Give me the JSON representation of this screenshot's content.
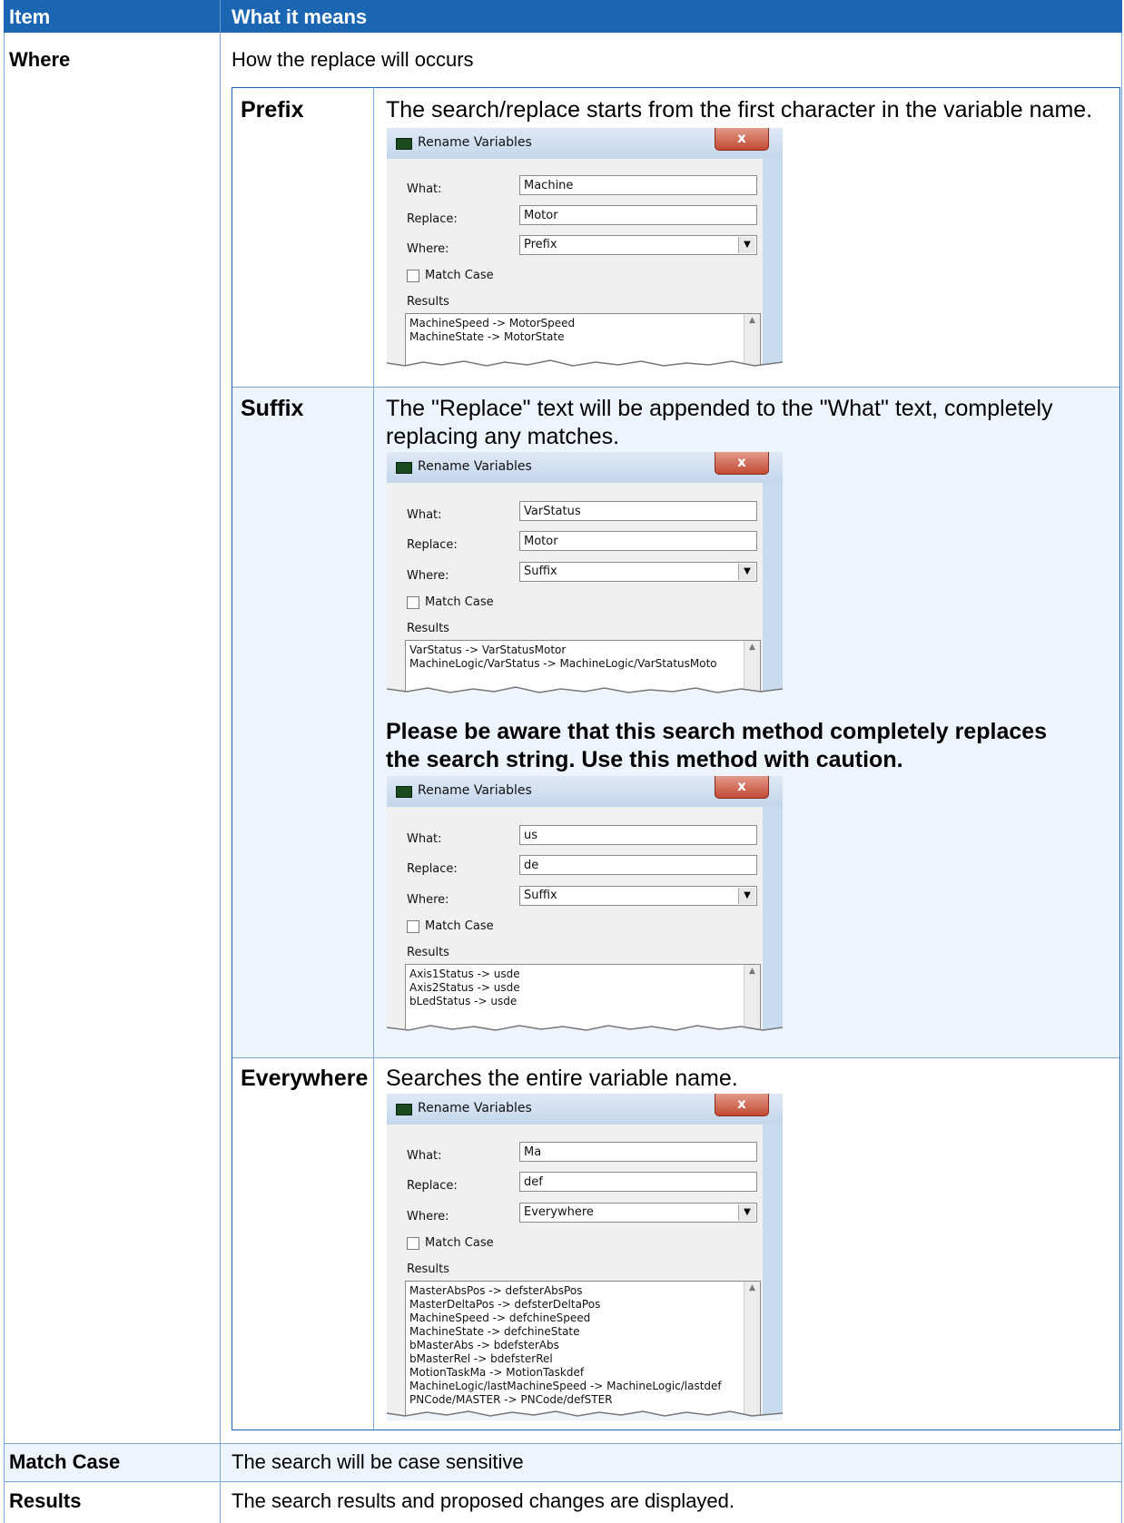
{
  "header": {
    "col_item": "Item",
    "col_meaning": "What it means"
  },
  "where": {
    "item": "Where",
    "description": "How the replace will occurs",
    "options": [
      {
        "name": "Prefix",
        "description": "The search/replace starts from the first character in the variable name.",
        "dialog": {
          "title": "Rename Variables",
          "close": "x",
          "what_label": "What:",
          "what": "Machine",
          "replace_label": "Replace:",
          "replace": "Motor",
          "where_label": "Where:",
          "where": "Prefix",
          "match_case": "Match Case",
          "results_label": "Results",
          "results": [
            "MachineSpeed -> MotorSpeed",
            "MachineState -> MotorState"
          ]
        }
      },
      {
        "name": "Suffix",
        "description_line1": "The \"Replace\" text will be appended to the \"What\" text, completely",
        "description_line2": "replacing any matches.",
        "dialog": {
          "title": "Rename Variables",
          "close": "x",
          "what_label": "What:",
          "what": "VarStatus",
          "replace_label": "Replace:",
          "replace": "Motor",
          "where_label": "Where:",
          "where": "Suffix",
          "match_case": "Match Case",
          "results_label": "Results",
          "results": [
            "VarStatus -> VarStatusMotor",
            "MachineLogic/VarStatus -> MachineLogic/VarStatusMoto"
          ]
        },
        "warning_line1": "Please be aware that this search method completely replaces",
        "warning_line2": "the search string. Use this method with caution.",
        "dialog2": {
          "title": "Rename Variables",
          "close": "x",
          "what_label": "What:",
          "what": "us",
          "replace_label": "Replace:",
          "replace": "de",
          "where_label": "Where:",
          "where": "Suffix",
          "match_case": "Match Case",
          "results_label": "Results",
          "results": [
            "Axis1Status -> usde",
            "Axis2Status -> usde",
            "bLedStatus -> usde"
          ]
        }
      },
      {
        "name": "Everywhere",
        "description": "Searches the entire variable name.",
        "dialog": {
          "title": "Rename Variables",
          "close": "x",
          "what_label": "What:",
          "what": "Ma",
          "replace_label": "Replace:",
          "replace": "def",
          "where_label": "Where:",
          "where": "Everywhere",
          "match_case": "Match Case",
          "results_label": "Results",
          "results": [
            "MasterAbsPos -> defsterAbsPos",
            "MasterDeltaPos -> defsterDeltaPos",
            "MachineSpeed -> defchineSpeed",
            "MachineState -> defchineState",
            "bMasterAbs -> bdefsterAbs",
            "bMasterRel -> bdefsterRel",
            "MotionTaskMa -> MotionTaskdef",
            "MachineLogic/lastMachineSpeed -> MachineLogic/lastdef",
            "PNCode/MASTER -> PNCode/defSTER"
          ]
        }
      }
    ]
  },
  "rows": [
    {
      "item": "Match Case",
      "description": "The search will be case sensitive"
    },
    {
      "item": "Results",
      "description": "The search results and proposed changes are displayed."
    }
  ]
}
